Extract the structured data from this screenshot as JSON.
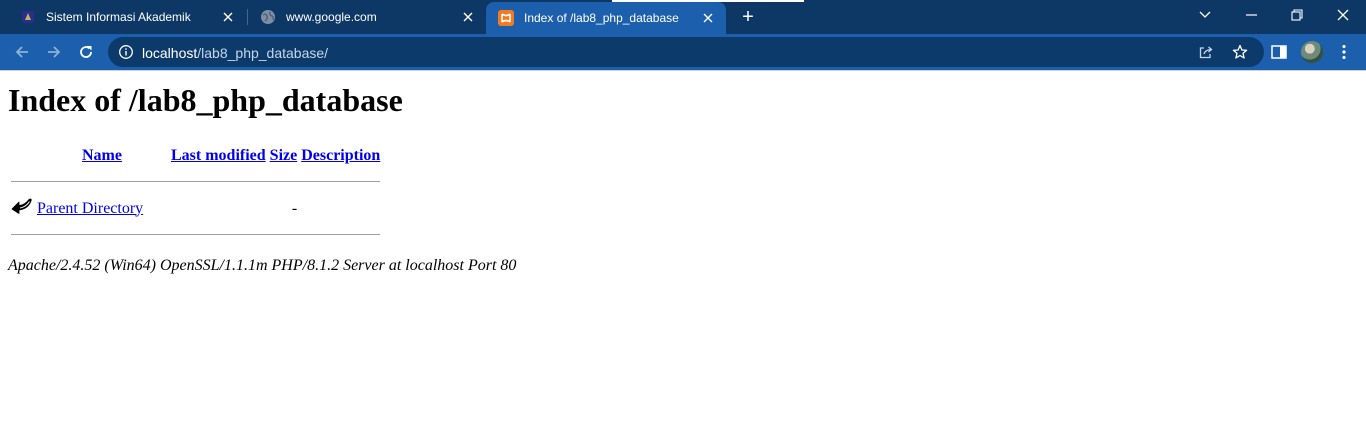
{
  "browser": {
    "tabs": [
      {
        "title": "Sistem Informasi Akademik",
        "favicon": "university-logo-icon",
        "active": false
      },
      {
        "title": "www.google.com",
        "favicon": "globe-icon",
        "active": false
      },
      {
        "title": "Index of /lab8_php_database",
        "favicon": "xampp-icon",
        "active": true
      }
    ],
    "new_tab_label": "+",
    "address": {
      "host": "localhost",
      "path": "/lab8_php_database/"
    },
    "colors": {
      "tabstrip": "#0d3865",
      "toolbar": "#1b5fad",
      "omnibox": "#0c3a6b",
      "xampp": "#f47a20"
    }
  },
  "page": {
    "heading": "Index of /lab8_php_database",
    "columns": {
      "name": "Name",
      "last_modified": "Last modified",
      "size": "Size",
      "description": "Description"
    },
    "rows": [
      {
        "icon": "back-arrow-icon",
        "name": "Parent Directory",
        "last_modified": "",
        "size": "-",
        "description": ""
      }
    ],
    "server_signature": "Apache/2.4.52 (Win64) OpenSSL/1.1.1m PHP/8.1.2 Server at localhost Port 80"
  }
}
